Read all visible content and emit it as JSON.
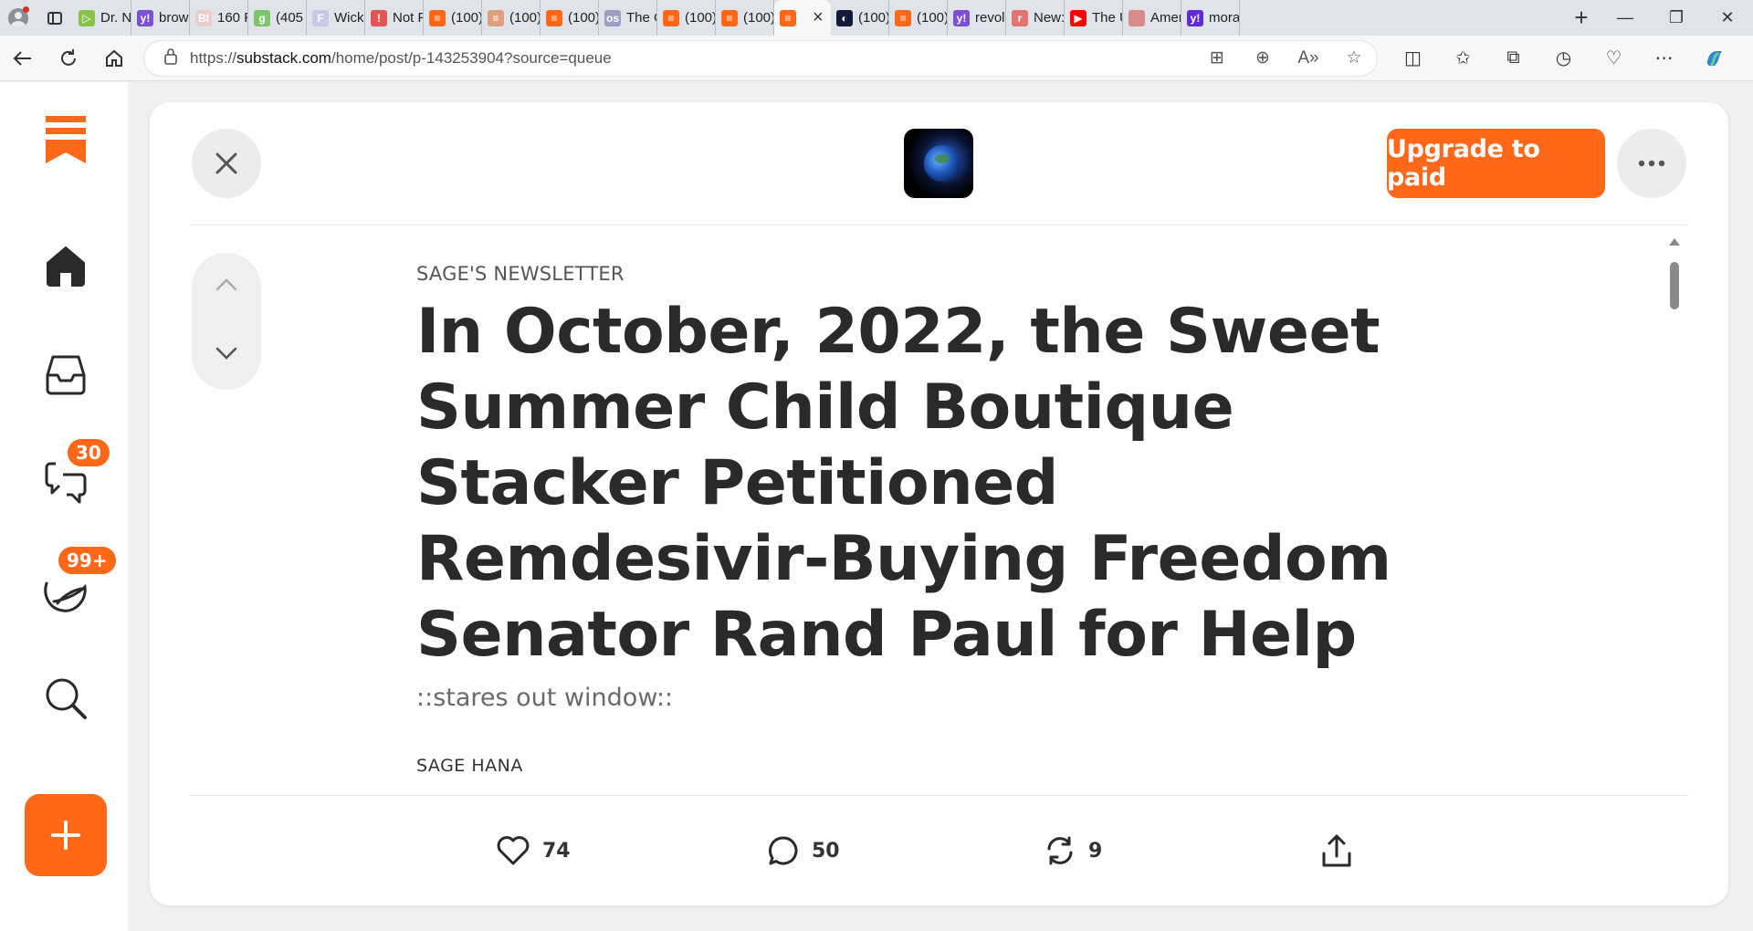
{
  "browser": {
    "tabs": [
      {
        "label": "Dr. N",
        "fav_color": "#8bc34a",
        "fav_glyph": "▷"
      },
      {
        "label": "brow",
        "fav_color": "#7b4fd6",
        "fav_glyph": "y!"
      },
      {
        "label": "160 F",
        "fav_color": "#e8cfc9",
        "fav_glyph": "BI"
      },
      {
        "label": "(405",
        "fav_color": "#7ec46a",
        "fav_glyph": "g"
      },
      {
        "label": "Wick",
        "fav_color": "#c8c8e8",
        "fav_glyph": "F"
      },
      {
        "label": "Not F",
        "fav_color": "#e25555",
        "fav_glyph": "!"
      },
      {
        "label": "(100)",
        "fav_color": "#ff6719",
        "fav_glyph": "≡"
      },
      {
        "label": "(100)",
        "fav_color": "#e0a080",
        "fav_glyph": "≡"
      },
      {
        "label": "(100)",
        "fav_color": "#ff6719",
        "fav_glyph": "≡"
      },
      {
        "label": "The C",
        "fav_color": "#9aa0c0",
        "fav_glyph": "os"
      },
      {
        "label": "(100)",
        "fav_color": "#ff6719",
        "fav_glyph": "≡"
      },
      {
        "label": "(100)",
        "fav_color": "#ff6719",
        "fav_glyph": "≡"
      },
      {
        "label": "",
        "fav_color": "#ff6719",
        "fav_glyph": "≡",
        "active": true
      },
      {
        "label": "(100)",
        "fav_color": "#111a3a",
        "fav_glyph": "◐"
      },
      {
        "label": "(100)",
        "fav_color": "#ff6719",
        "fav_glyph": "≡"
      },
      {
        "label": "revol",
        "fav_color": "#7b4fd6",
        "fav_glyph": "y!"
      },
      {
        "label": "New:",
        "fav_color": "#e57373",
        "fav_glyph": "r"
      },
      {
        "label": "The U",
        "fav_color": "#ff0000",
        "fav_glyph": "▶"
      },
      {
        "label": "Amer",
        "fav_color": "#d98a8a",
        "fav_glyph": ""
      },
      {
        "label": "mora",
        "fav_color": "#5f2bd6",
        "fav_glyph": "y!"
      }
    ],
    "url_prefix": "https://",
    "url_domain": "substack.com",
    "url_path": "/home/post/p-143253904?source=queue"
  },
  "sidebar": {
    "chat_badge": "30",
    "activity_badge": "99+"
  },
  "header": {
    "upgrade_label": "Upgrade to paid"
  },
  "article": {
    "publication": "SAGE'S NEWSLETTER",
    "title": "In October, 2022, the Sweet Summer Child Boutique Stacker Petitioned Remdesivir-Buying Freedom Senator Rand Paul for Help",
    "subtitle": "::stares out window::",
    "author": "SAGE HANA"
  },
  "actions": {
    "likes": "74",
    "comments": "50",
    "restacks": "9"
  },
  "colors": {
    "accent": "#ff6719"
  }
}
